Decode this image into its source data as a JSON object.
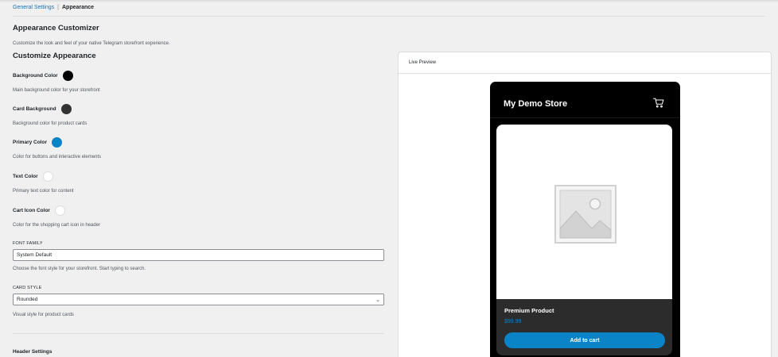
{
  "breadcrumb": {
    "parent": "General Settings",
    "separator": "|",
    "current": "Appearance"
  },
  "page": {
    "title": "Appearance Customizer",
    "intro": "Customize the look and feel of your native Telegram storefront experience.",
    "section_title": "Customize Appearance"
  },
  "settings": [
    {
      "label": "Background Color",
      "color": "#000000",
      "description": "Main background color for your storefront"
    },
    {
      "label": "Card Background",
      "color": "#333333",
      "description": "Background color for product cards"
    },
    {
      "label": "Primary Color",
      "color": "#0a84c6",
      "description": "Color for buttons and interactive elements"
    },
    {
      "label": "Text Color",
      "color": "#ffffff",
      "description": "Primary text color for content"
    },
    {
      "label": "Cart Icon Color",
      "color": "#ffffff",
      "description": "Color for the shopping cart icon in header"
    }
  ],
  "font_family": {
    "label": "FONT FAMILY",
    "value": "System Default",
    "help": "Choose the font style for your storefront. Start typing to search."
  },
  "card_style": {
    "label": "CARD STYLE",
    "value": "Rounded",
    "help": "Visual style for product cards"
  },
  "header_settings": {
    "title": "Header Settings"
  },
  "preview": {
    "title": "Live Preview",
    "store_name": "My Demo Store",
    "product_name": "Premium Product",
    "product_price": "$99.99",
    "button_label": "Add to cart"
  },
  "icons": {
    "cart": "shopping-cart-icon",
    "placeholder": "image-placeholder-icon"
  }
}
